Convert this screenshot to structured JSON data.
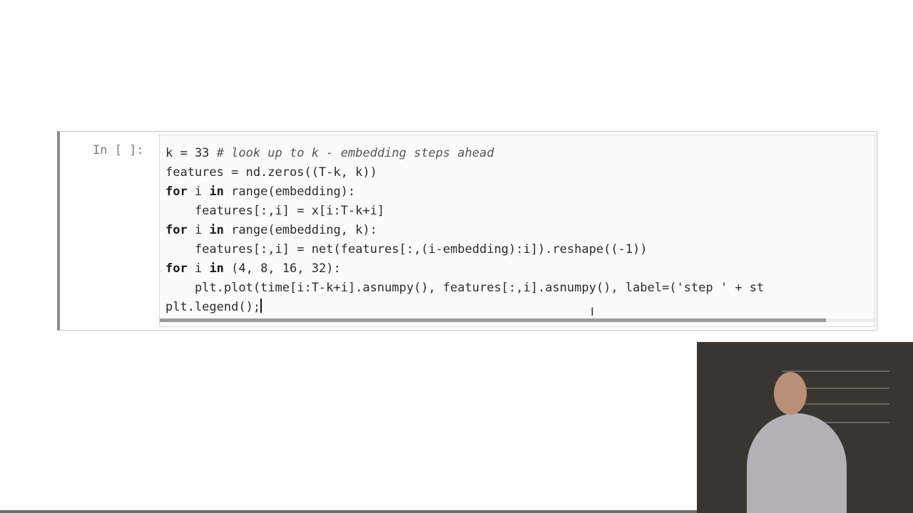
{
  "cell": {
    "prompt": "In [ ]:",
    "code_lines": [
      [
        {
          "t": "k = 33 ",
          "c": ""
        },
        {
          "t": "# look up to k - embedding steps ahead",
          "c": "cm"
        }
      ],
      [
        {
          "t": "features = nd.zeros((T-k, k))",
          "c": ""
        }
      ],
      [
        {
          "t": "for",
          "c": "kw"
        },
        {
          "t": " i ",
          "c": ""
        },
        {
          "t": "in",
          "c": "kw"
        },
        {
          "t": " range(embedding):",
          "c": ""
        }
      ],
      [
        {
          "t": "    features[:,i] = x[i:T-k+i]",
          "c": ""
        }
      ],
      [
        {
          "t": "for",
          "c": "kw"
        },
        {
          "t": " i ",
          "c": ""
        },
        {
          "t": "in",
          "c": "kw"
        },
        {
          "t": " range(embedding, k):",
          "c": ""
        }
      ],
      [
        {
          "t": "    features[:,i] = net(features[:,(i-embedding):i]).reshape((-1))",
          "c": ""
        }
      ],
      [
        {
          "t": "for",
          "c": "kw"
        },
        {
          "t": " i ",
          "c": ""
        },
        {
          "t": "in",
          "c": "kw"
        },
        {
          "t": " (4, 8, 16, 32):",
          "c": ""
        }
      ],
      [
        {
          "t": "    plt.plot(time[i:T-k+i].asnumpy(), features[:,i].asnumpy(), label=('step ' + st",
          "c": ""
        }
      ],
      [
        {
          "t": "plt.legend();",
          "c": ""
        }
      ]
    ]
  },
  "icons": {
    "mouse_cursor": "text-ibeam-cursor-icon",
    "webcam": "presenter-webcam-overlay"
  },
  "colors": {
    "cell_border_left": "#8a8a8a",
    "editor_background": "#fbfbfb",
    "prompt_color": "#7a7a7a"
  }
}
